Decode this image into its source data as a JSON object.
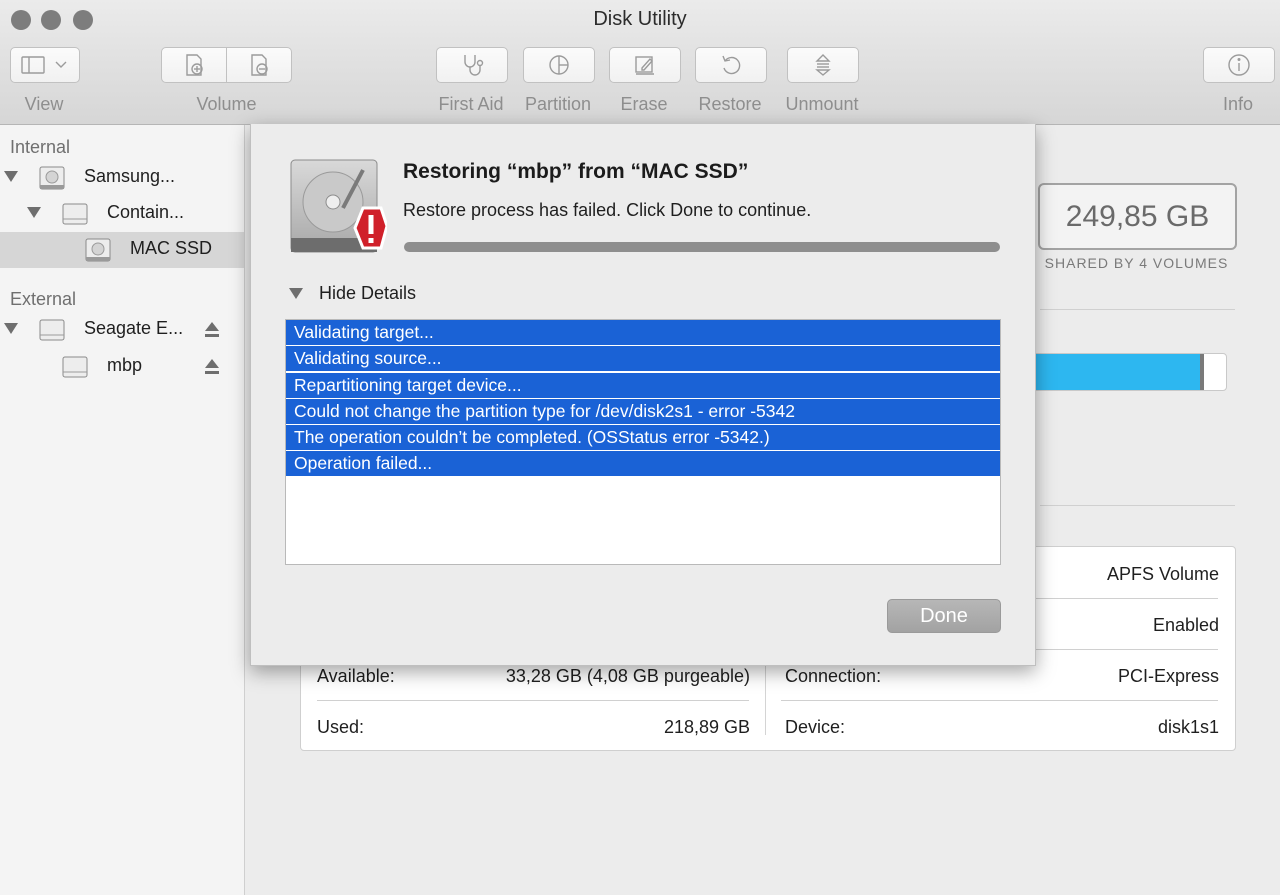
{
  "window": {
    "title": "Disk Utility"
  },
  "toolbar": {
    "view_label": "View",
    "volume_label": "Volume",
    "first_aid_label": "First Aid",
    "partition_label": "Partition",
    "erase_label": "Erase",
    "restore_label": "Restore",
    "unmount_label": "Unmount",
    "info_label": "Info"
  },
  "sidebar": {
    "internal_header": "Internal",
    "external_header": "External",
    "items": [
      {
        "label": "Samsung...",
        "icon": "internal-disk-icon",
        "expanded": true
      },
      {
        "label": "Contain...",
        "icon": "container-icon",
        "expanded": true
      },
      {
        "label": "MAC SSD",
        "icon": "volume-icon",
        "selected": true
      },
      {
        "label": "Seagate E...",
        "icon": "external-disk-icon",
        "expanded": true
      },
      {
        "label": "mbp",
        "icon": "external-volume-icon"
      }
    ]
  },
  "main": {
    "capacity": "249,85 GB",
    "shared": "SHARED BY 4 VOLUMES",
    "usage_fraction": 0.87,
    "info": {
      "type_value": "APFS Volume",
      "owners_value": "Enabled",
      "available_label": "Available:",
      "available_value": "33,28 GB (4,08 GB purgeable)",
      "used_label": "Used:",
      "used_value": "218,89 GB",
      "connection_label": "Connection:",
      "connection_value": "PCI-Express",
      "device_label": "Device:",
      "device_value": "disk1s1"
    }
  },
  "sheet": {
    "title": "Restoring “mbp” from “MAC SSD”",
    "message": "Restore process has failed. Click Done to continue.",
    "progress_fraction": 1.0,
    "details_toggle": "Hide Details",
    "log": [
      "Validating target...",
      "Validating source...",
      "Repartitioning target device...",
      "Could not change the partition type for /dev/disk2s1 - error -5342",
      "The operation couldn’t be completed. (OSStatus error -5342.)",
      "Operation failed..."
    ],
    "done_label": "Done"
  },
  "colors": {
    "selection_blue": "#1a62d6",
    "usage_blue": "#2db7f0",
    "alert_red": "#d0202a"
  }
}
